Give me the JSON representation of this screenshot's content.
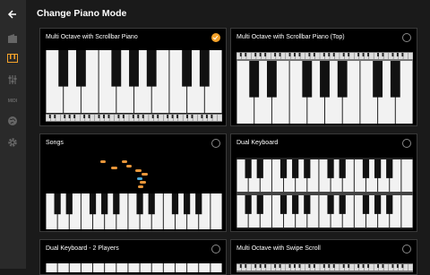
{
  "header": {
    "title": "Change Piano Mode"
  },
  "sidebar": {
    "items": [
      {
        "icon": "back-arrow-icon"
      },
      {
        "icon": "record-icon"
      },
      {
        "icon": "piano-mode-icon",
        "active": true
      },
      {
        "icon": "sliders-icon"
      },
      {
        "icon": "midi-icon",
        "text": "MIDI"
      },
      {
        "icon": "globe-icon"
      },
      {
        "icon": "gear-icon"
      }
    ]
  },
  "modes": [
    {
      "label": "Multi Octave with Scrollbar Piano",
      "selected": true
    },
    {
      "label": "Multi Octave with Scrollbar Piano (Top)",
      "selected": false
    },
    {
      "label": "Songs",
      "selected": false
    },
    {
      "label": "Dual Keyboard",
      "selected": false
    },
    {
      "label": "Dual Keyboard - 2 Players",
      "selected": false
    },
    {
      "label": "Multi Octave with Swipe Scroll",
      "selected": false
    }
  ],
  "colors": {
    "accent": "#f4a22a",
    "note": "#e8963a",
    "note_alt": "#4aa8d8"
  }
}
